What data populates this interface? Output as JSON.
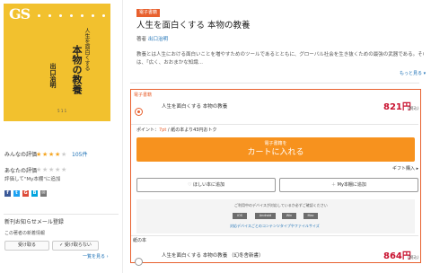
{
  "cover": {
    "logo": "GS",
    "subtitle": "人生を面白くする",
    "title": "本物の教養",
    "author": "出口治明",
    "number": "5 1 1"
  },
  "rating": {
    "everyone_label": "みんなの評価",
    "stars": 4,
    "count": "105件",
    "yours_label": "あなたの評価",
    "my_shelf_text": "評価して\"My本棚\"に追加"
  },
  "share": {
    "icons": [
      "facebook-icon",
      "twitter-icon",
      "googleplus-icon",
      "hatena-icon",
      "mail-icon"
    ],
    "colors": [
      "#3b5998",
      "#1da1f2",
      "#dd4b39",
      "#00a4de",
      "#777777"
    ]
  },
  "notify": {
    "heading": "新刊お知らせメール登録",
    "sub": "この著者の新着情報",
    "receive_label": "受け取る",
    "no_receive_label": "受け取らない",
    "list_link": "一覧を見る"
  },
  "product": {
    "badge": "電子書籍",
    "title": "人生を面白くする 本物の教養",
    "author_label": "著者",
    "author": "出口治明",
    "description_lines": [
      "教養とは人生における面白いことを増やすためのツールであるとともに、グローバル社会を生き抜くための最強の武器である。その教養を身につけるに",
      "は、「広く、おおまかな知識..."
    ],
    "more_link": "もっと見る"
  },
  "ebook_option": {
    "label": "電子書籍",
    "name": "人生を面白くする 本物の教養",
    "price": "821円",
    "tax": "(税込)",
    "points_prefix": "ポイント：",
    "points_value": "7pt",
    "points_suffix": " / 紙の本より43円おトク"
  },
  "cart": {
    "sub_label": "電子書籍を",
    "main_label": "カートに入れる",
    "gift": "ギフト購入 ▸"
  },
  "wishlist": {
    "want_label": "ほしい本に追加",
    "myshelf_label": "My本棚に追加"
  },
  "devices": {
    "notice": "ご利用中のデバイスが対応しているか必ずご確認ください",
    "list": [
      "iOS",
      "Android",
      "Win",
      "Mac"
    ],
    "link": "対応デバイスごとのコンテンツタイプやファイルサイズ"
  },
  "paper_option": {
    "label": "紙の本",
    "name": "人生を面白くする 本物の教養 （幻冬舎新書）",
    "price": "864円",
    "tax": "(税込)"
  }
}
